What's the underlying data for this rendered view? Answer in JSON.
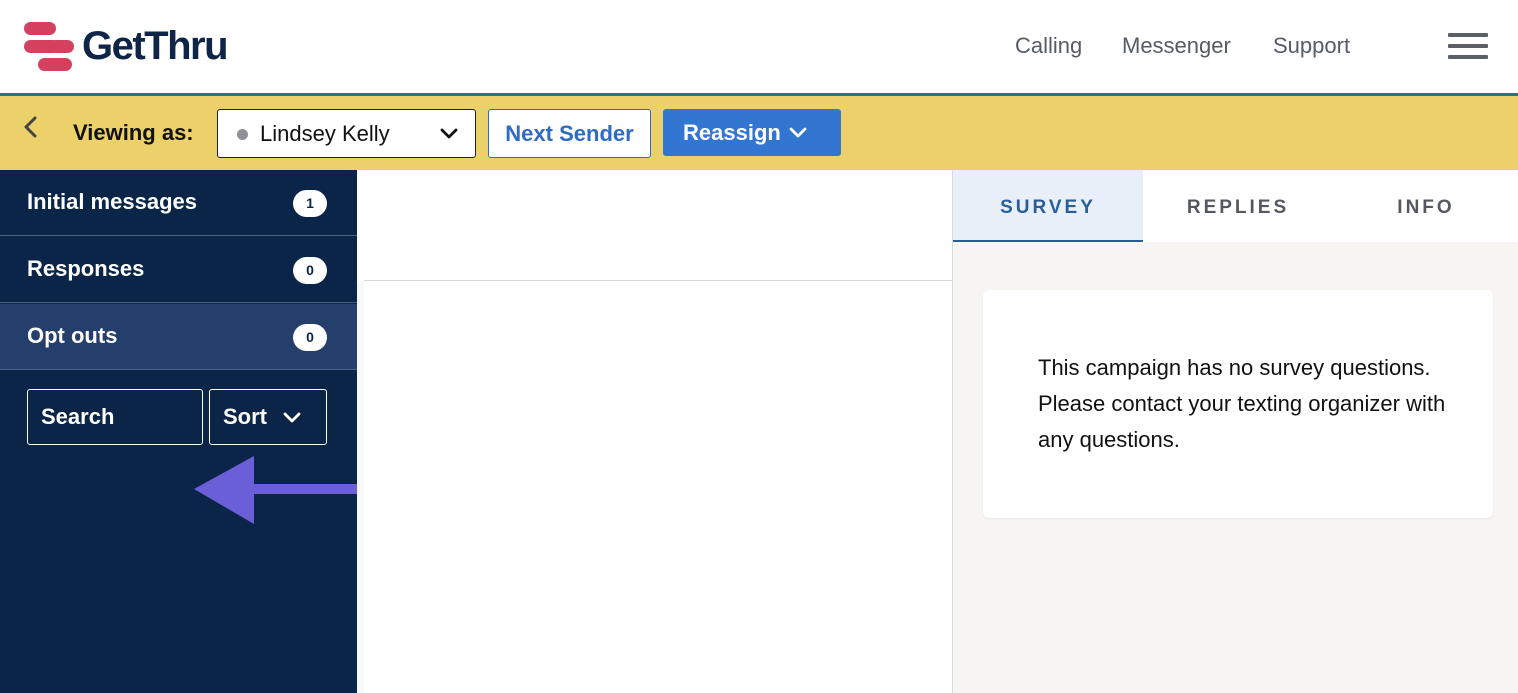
{
  "header": {
    "logo_text": "GetThru",
    "nav": {
      "calling": "Calling",
      "messenger": "Messenger",
      "support": "Support"
    },
    "brand_colors": {
      "logo_mark": "#d6405f",
      "logo_text": "#0f2547",
      "rule": "#138080"
    }
  },
  "toolbar": {
    "viewing_label": "Viewing as:",
    "sender": {
      "name": "Lindsey Kelly",
      "status": "offline"
    },
    "next_sender_label": "Next Sender",
    "reassign_label": "Reassign",
    "background": "#ecd069"
  },
  "sidebar": {
    "items": [
      {
        "label": "Initial messages",
        "count": "1"
      },
      {
        "label": "Responses",
        "count": "0"
      },
      {
        "label": "Opt outs",
        "count": "0",
        "active": true
      }
    ],
    "search_label": "Search",
    "sort_label": "Sort",
    "background": "#0b2548"
  },
  "annotation": {
    "icon": "left-arrow-icon",
    "color": "#6a5fd6"
  },
  "rightpanel": {
    "tabs": [
      {
        "label": "SURVEY",
        "active": true
      },
      {
        "label": "REPLIES"
      },
      {
        "label": "INFO"
      }
    ],
    "message": "This campaign has no survey questions. Please contact your texting organizer with any questions."
  }
}
